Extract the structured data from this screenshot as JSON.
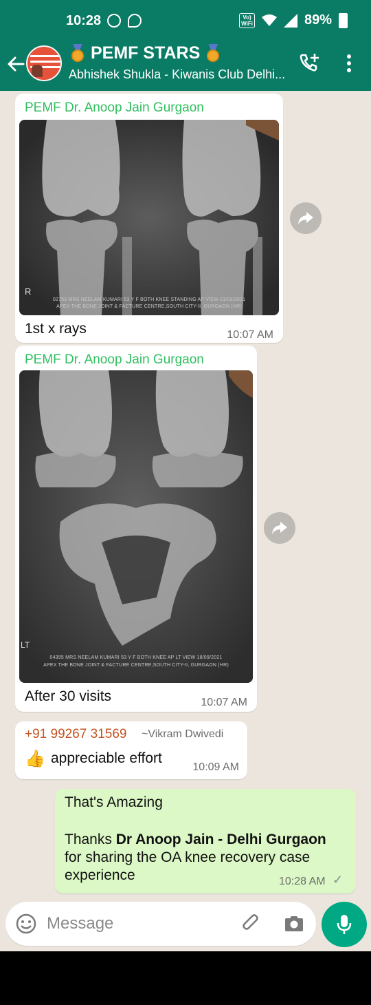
{
  "status_bar": {
    "time": "10:28",
    "network": "Vo) WiFi",
    "battery": "89%"
  },
  "header": {
    "group_name": "PEMF STARS",
    "subtitle": "Abhishek Shukla - Kiwanis Club Delhi...",
    "avatar_text": [
      "DRUG FREE",
      "SURGERY FREE",
      "PAIN FREE"
    ],
    "icons": [
      "back-arrow-icon",
      "add-call-icon",
      "more-vertical-icon"
    ]
  },
  "messages": [
    {
      "sender": "PEMF Dr. Anoop Jain Gurgaon",
      "type": "image",
      "image_caption_text": [
        "02753 MRS NEELAM KUMARI 53 Y F BOTH KNEE STANDING AP VIEW 01/03/2021",
        "APEX THE BONE JOINT & FACTURE CENTRE,SOUTH CITY-II, GURGAON (HR)"
      ],
      "image_marker": "R",
      "caption": "1st x rays",
      "time": "10:07 AM"
    },
    {
      "sender": "PEMF Dr. Anoop Jain Gurgaon",
      "type": "image",
      "image_caption_text": [
        "04395 MRS NEELAM KUMARI 53 Y F BOTH KNEE AP LT VIEW 18/09/2021",
        "APEX THE BONE JOINT & FACTURE CENTRE,SOUTH CITY-II, GURGAON (HR)"
      ],
      "image_marker": "LT",
      "caption": "After 30 visits",
      "time": "10:07 AM"
    },
    {
      "sender": "+91 99267 31569",
      "sender_name": "~Vikram Dwivedi",
      "type": "text",
      "emoji": "👍",
      "text": "appreciable effort",
      "time": "10:09 AM"
    },
    {
      "type": "outgoing",
      "line1": "That's Amazing",
      "line2_prefix": "Thanks ",
      "line2_bold": "Dr Anoop Jain - Delhi Gurgaon",
      "line3": "for sharing the OA knee recovery case",
      "line4": "experience",
      "time": "10:28 AM",
      "status": "✓"
    }
  ],
  "input": {
    "placeholder": "Message"
  },
  "colors": {
    "header": "#0a7b64",
    "chat_bg": "#ece5dd",
    "outgoing": "#dcf8c6",
    "sender_green": "#2fbf5f",
    "sender_orange": "#c4531f",
    "mic": "#00a884"
  }
}
